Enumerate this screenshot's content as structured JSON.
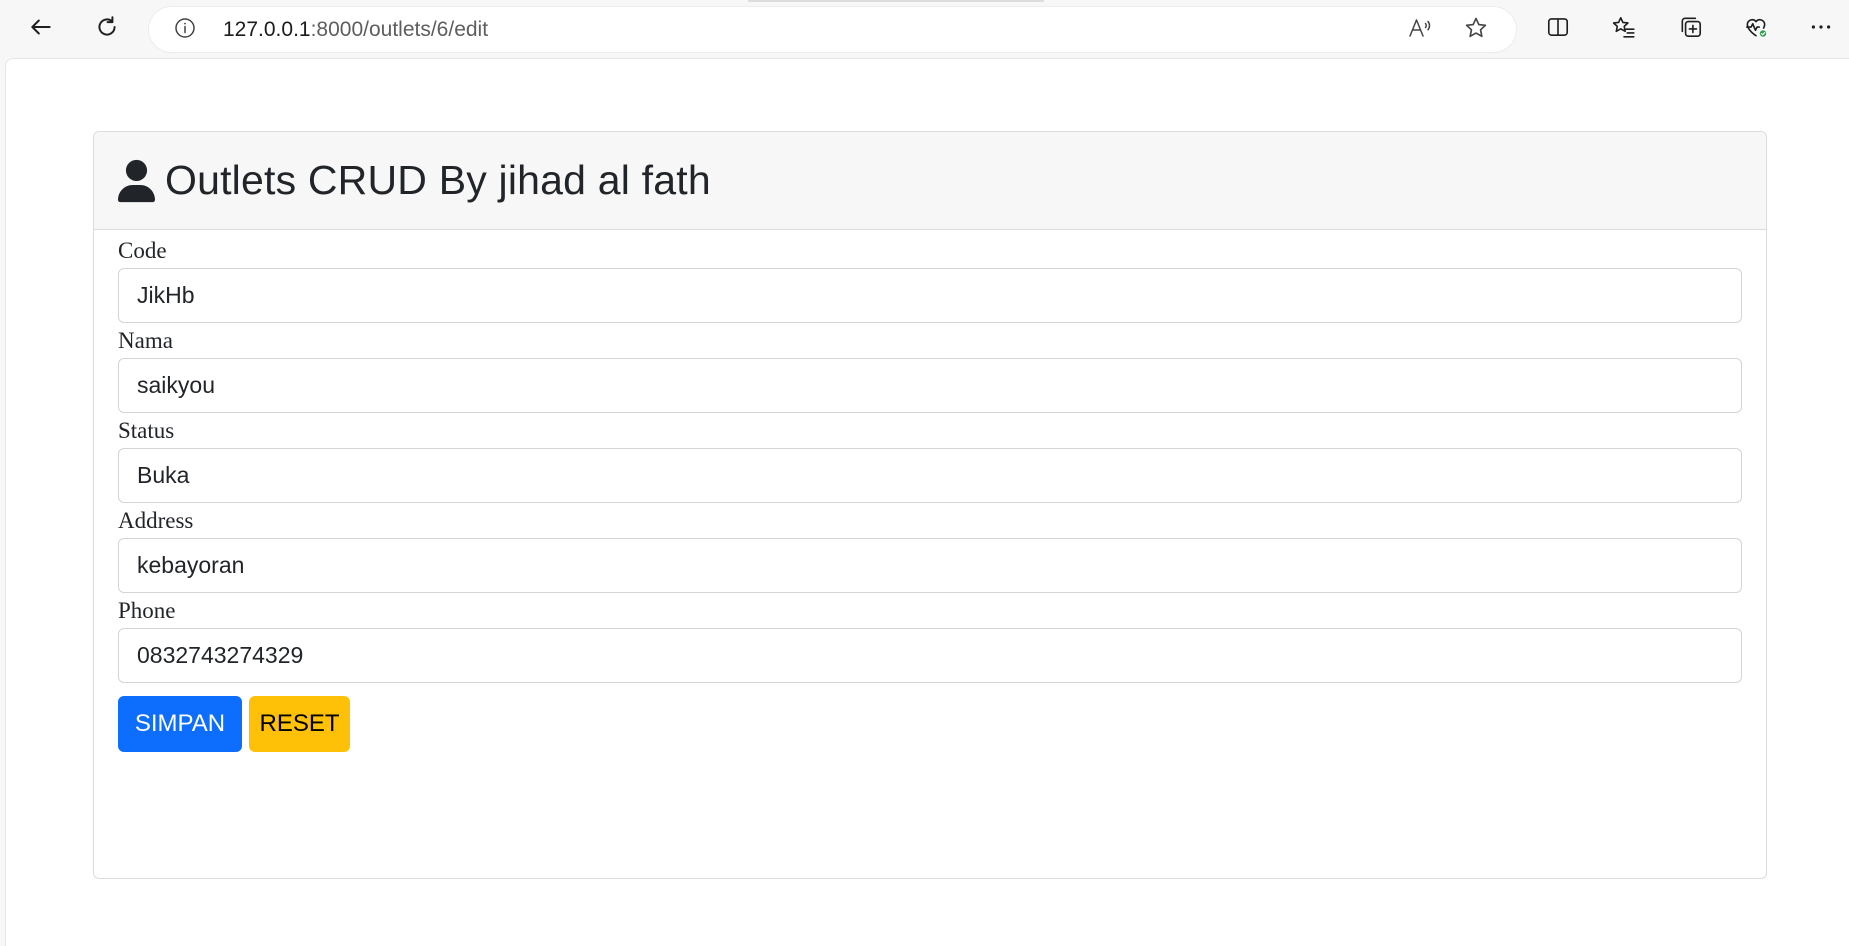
{
  "browser": {
    "url_host": "127.0.0.1",
    "url_rest": ":8000/outlets/6/edit",
    "icons": {
      "back": "arrow-left-icon",
      "refresh": "refresh-icon",
      "site_info": "info-circle-icon",
      "read_aloud": "read-aloud-icon",
      "favorite": "star-icon",
      "split_screen": "split-screen-icon",
      "favorites": "favorites-list-icon",
      "collections": "collections-icon",
      "browser_essentials": "heart-pulse-icon",
      "more": "more-dots-icon"
    },
    "status_dot_color": "#2e9e4b"
  },
  "card": {
    "title": "Outlets CRUD By jihad al fath",
    "header_icon": "user-icon"
  },
  "form": {
    "fields": [
      {
        "label": "Code",
        "value": "JikHb"
      },
      {
        "label": "Nama",
        "value": "saikyou"
      },
      {
        "label": "Status",
        "value": "Buka"
      },
      {
        "label": "Address",
        "value": "kebayoran"
      },
      {
        "label": "Phone",
        "value": "0832743274329"
      }
    ],
    "submit_label": "SIMPAN",
    "reset_label": "RESET"
  },
  "colors": {
    "primary": "#0d6efd",
    "warning": "#ffc107",
    "header_bg": "#f7f7f7"
  }
}
